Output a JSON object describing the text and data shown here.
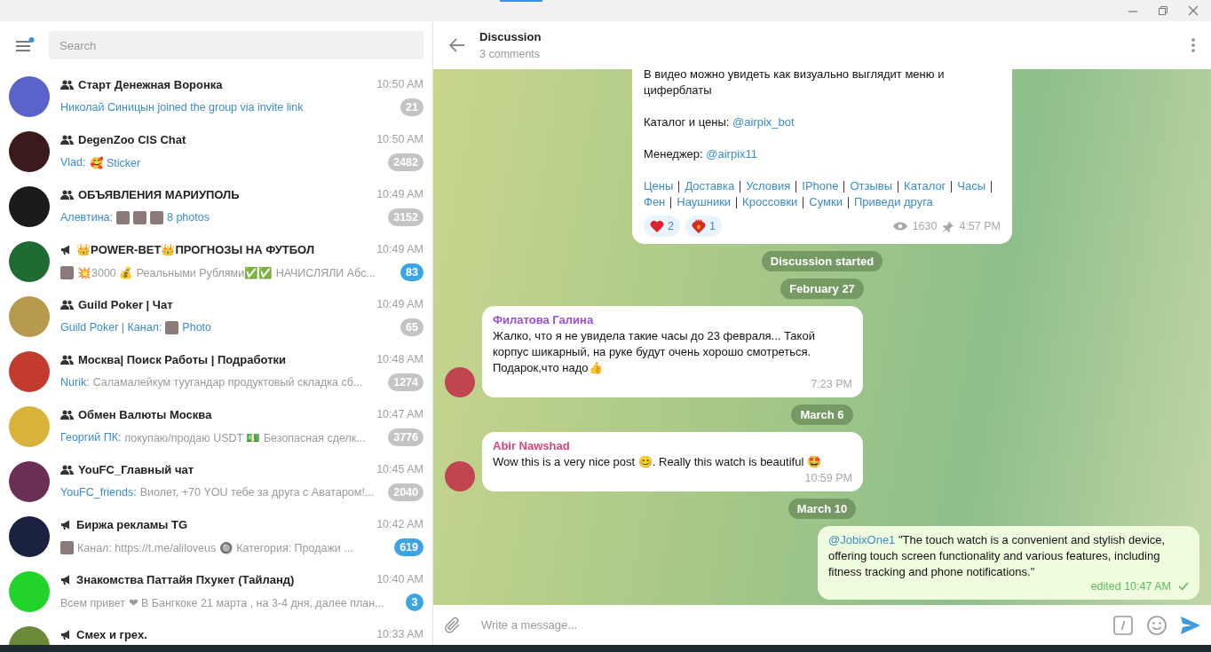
{
  "sidebar": {
    "menu_has_notification": true,
    "search": {
      "placeholder": "Search"
    },
    "chats": [
      {
        "kind": "group",
        "name": "Старт Денежная Воронка",
        "time": "10:50 AM",
        "preview": [
          {
            "kind": "service",
            "text": "Николай Синицын joined the group via invite link"
          }
        ],
        "unread": "21",
        "muted": true
      },
      {
        "kind": "group",
        "name": "DegenZoo CIS Chat",
        "time": "10:50 AM",
        "preview": [
          {
            "kind": "sender",
            "text": "Vlad:"
          },
          {
            "kind": "media",
            "text": "🥰 Sticker"
          }
        ],
        "unread": "2482",
        "muted": true
      },
      {
        "kind": "group",
        "name": "ОБЪЯВЛЕНИЯ МАРИУПОЛЬ",
        "time": "10:49 AM",
        "preview": [
          {
            "kind": "sender",
            "text": "Алевтина:"
          },
          {
            "kind": "thumb"
          },
          {
            "kind": "thumb"
          },
          {
            "kind": "thumb"
          },
          {
            "kind": "media",
            "text": "8 photos"
          }
        ],
        "unread": "3152",
        "muted": true
      },
      {
        "kind": "channel",
        "name": "👑POWER-BET👑ПРОГНОЗЫ НА ФУТБОЛ",
        "time": "10:49 AM",
        "preview": [
          {
            "kind": "thumb"
          },
          {
            "kind": "text",
            "text": "💥3000 💰 Реальными Рублями✅✅ НАЧИСЛЯЛИ Абс..."
          }
        ],
        "unread": "83",
        "muted": false
      },
      {
        "kind": "group",
        "name": "Guild Poker | Чат",
        "time": "10:49 AM",
        "preview": [
          {
            "kind": "sender",
            "text": "Guild Poker | Канал:"
          },
          {
            "kind": "thumb"
          },
          {
            "kind": "media",
            "text": "Photo"
          }
        ],
        "unread": "65",
        "muted": true
      },
      {
        "kind": "group",
        "name": "Москва| Поиск Работы | Подработки",
        "time": "10:48 AM",
        "preview": [
          {
            "kind": "sender",
            "text": "Nurik:"
          },
          {
            "kind": "text",
            "text": "Саламалейкум туугандар продуктовый складка сб..."
          }
        ],
        "unread": "1274",
        "muted": true
      },
      {
        "kind": "group",
        "name": "Обмен Валюты Москва",
        "time": "10:47 AM",
        "preview": [
          {
            "kind": "sender",
            "text": "Георгий ПК:"
          },
          {
            "kind": "text",
            "text": "покупаю/продаю USDT 💵 Безопасная сделк..."
          }
        ],
        "unread": "3776",
        "muted": true
      },
      {
        "kind": "group",
        "name": "YouFC_Главный чат",
        "time": "10:45 AM",
        "preview": [
          {
            "kind": "sender",
            "text": "YouFC_friends:"
          },
          {
            "kind": "text",
            "text": "Виолет, +70 YOU тебе за друга с Аватаром!..."
          }
        ],
        "unread": "2040",
        "muted": true
      },
      {
        "kind": "channel",
        "name": "Биржа рекламы TG",
        "time": "10:42 AM",
        "preview": [
          {
            "kind": "thumb"
          },
          {
            "kind": "text",
            "text": "Канал: https://t.me/aliloveus 🔘 Категория: Продажи ..."
          }
        ],
        "unread": "619",
        "muted": false
      },
      {
        "kind": "channel",
        "name": "Знакомства Паттайя Пхукет (Тайланд)",
        "time": "10:40 AM",
        "preview": [
          {
            "kind": "text",
            "text": "Всем привет ❤ В Бангкоке 21 марта , на 3-4 дня, далее план..."
          }
        ],
        "unread": "3",
        "muted": false
      },
      {
        "kind": "channel",
        "name": "Смех и грех.",
        "time": "10:33 AM"
      }
    ]
  },
  "chat": {
    "title": "Discussion",
    "subtitle": "3 comments",
    "post": {
      "lines": [
        "В видео можно увидеть как визуально выглядит меню и циферблаты"
      ],
      "fields": [
        {
          "label": "Каталог и цены:",
          "link": "@airpix_bot"
        },
        {
          "label": "Менеджер:",
          "link": "@airpix11"
        }
      ],
      "links": [
        "Цены",
        "Доставка",
        "Условия",
        "IPhone",
        "Отзывы",
        "Каталог",
        "Часы",
        "Фен",
        "Наушники",
        "Кроссовки",
        "Сумки",
        "Приведи друга"
      ],
      "reactions": [
        {
          "kind": "heart",
          "count": "2"
        },
        {
          "kind": "heart-fire",
          "count": "1"
        }
      ],
      "views": "1630",
      "pinned": true,
      "time": "4:57 PM"
    },
    "items": [
      {
        "kind": "service",
        "text": "Discussion started"
      },
      {
        "kind": "service",
        "text": "February 27"
      },
      {
        "kind": "incoming",
        "author": "Филатова Галина",
        "color": "#9b4fd6",
        "text": "Жалко, что я не увидела такие часы до 23 февраля... Такой корпус шикарный, на руке будут очень хорошо смотреться. Подарок,что надо👍",
        "time": "7:23 PM"
      },
      {
        "kind": "service",
        "text": "March 6"
      },
      {
        "kind": "incoming",
        "author": "Abir Nawshad",
        "color": "#d8457a",
        "text": "Wow this is a very nice post 😊. Really this watch is beautiful 🤩",
        "time": "10:59 PM"
      },
      {
        "kind": "service",
        "text": "March 10"
      },
      {
        "kind": "outgoing",
        "mention": "@JobixOne1",
        "text": "\"The touch watch is a convenient and stylish device, offering touch screen functionality and various features, including fitness tracking and phone notifications.\"",
        "time": "edited 10:47 AM",
        "read": false
      }
    ],
    "input": {
      "placeholder": "Write a message..."
    }
  }
}
